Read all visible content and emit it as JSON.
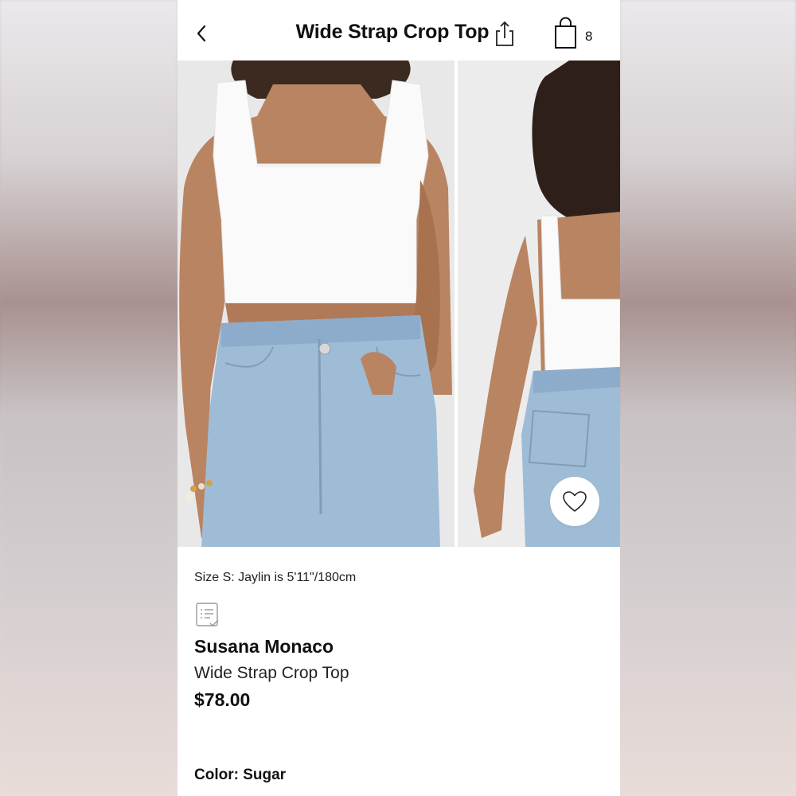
{
  "header": {
    "title": "Wide Strap Crop Top",
    "bag_count": "8",
    "icons": {
      "back": "chevron-left-icon",
      "share": "share-icon",
      "bag": "shopping-bag-icon"
    }
  },
  "gallery": {
    "images": [
      {
        "alt": "front view"
      },
      {
        "alt": "back view"
      }
    ],
    "favorite_icon": "heart-outline-icon"
  },
  "product": {
    "size_note": "Size S: Jaylin is 5'11\"/180cm",
    "size_chart_icon": "size-chart-icon",
    "brand": "Susana Monaco",
    "name": "Wide Strap Crop Top",
    "price": "$78.00",
    "color_label": "Color:",
    "color_value": "Sugar"
  },
  "colors": {
    "accent": "#111111",
    "background": "#ffffff"
  }
}
